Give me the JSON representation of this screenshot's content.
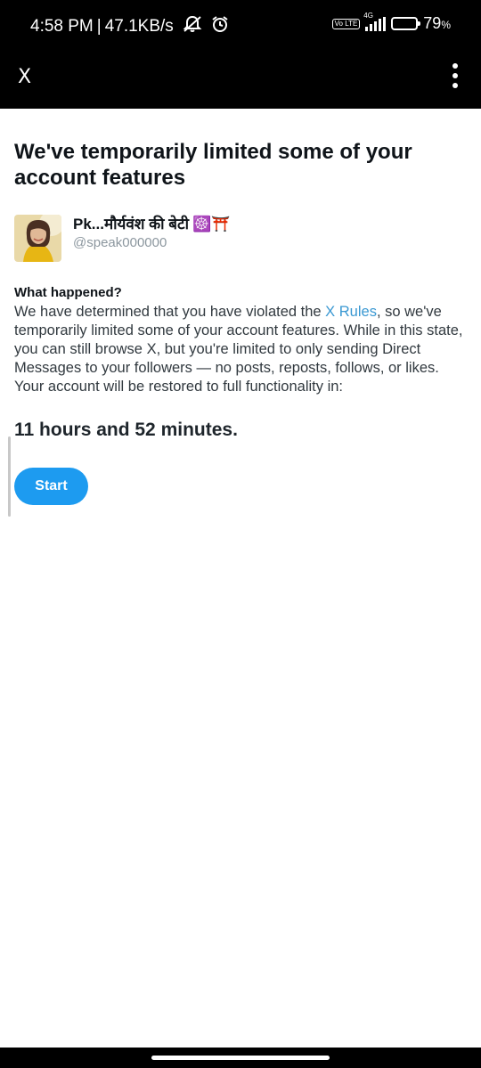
{
  "status_bar": {
    "time": "4:58 PM",
    "separator": "|",
    "network_speed": "47.1KB/s",
    "volte_label": "Vo LTE",
    "network_type": "4G",
    "battery_percent": "79",
    "battery_percent_symbol": "%",
    "battery_level": 0.79,
    "icons": [
      "silent-mode-icon",
      "alarm-icon",
      "volte-icon",
      "signal-icon",
      "battery-icon"
    ]
  },
  "app_bar": {
    "close_label": "X",
    "more_icon": "more-vertical-icon"
  },
  "notice": {
    "headline": "We've temporarily limited some of your account features",
    "user": {
      "display_name": "Pk...मौर्यवंश की बेटी",
      "name_emojis": "☸️⛩️",
      "handle": "@speak000000"
    },
    "section_title": "What happened?",
    "body_before_link": "We have determined that you have violated the ",
    "link_text": "X Rules",
    "body_after_link": ", so we've temporarily limited some of your account features. While in this state, you can still browse X, but you're limited to only sending Direct Messages to your followers — no posts, reposts, follows, or likes. Your account will be restored to full functionality in:",
    "time_remaining": "11 hours and 52 minutes.",
    "start_button": "Start"
  },
  "colors": {
    "accent": "#1d9bf0",
    "link": "#3a98d2",
    "text": "#0f1419",
    "handle": "#8c979f"
  }
}
